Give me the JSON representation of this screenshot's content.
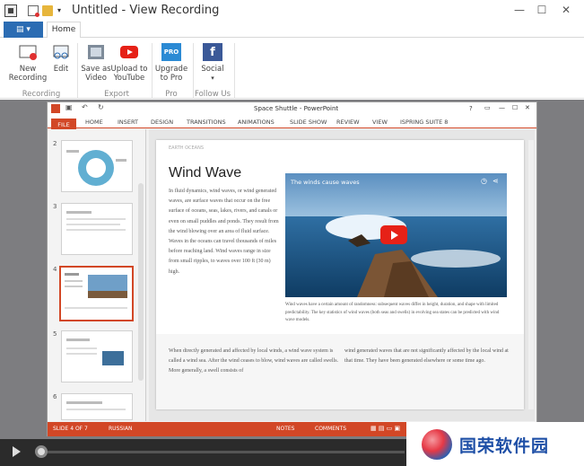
{
  "window": {
    "title": "Untitled - View Recording",
    "quick_access_more": "▾"
  },
  "window_controls": {
    "minimize": "—",
    "maximize": "☐",
    "close": "✕"
  },
  "ribbon": {
    "tab_home": "Home",
    "buttons": {
      "new_recording": "New\nRecording",
      "edit": "Edit",
      "save_as_video": "Save as\nVideo",
      "upload_youtube": "Upload to\nYouTube",
      "upgrade_pro": "Upgrade\nto Pro",
      "social": "Social"
    },
    "groups": {
      "recording": "Recording",
      "export": "Export",
      "pro": "Pro",
      "follow_us": "Follow Us"
    },
    "pro_badge": "PRO",
    "social_badge": "f",
    "colors": {
      "accent": "#2b6cb3",
      "youtube": "#e62117",
      "pro": "#2b8ad4",
      "facebook": "#3b5998"
    }
  },
  "ppt": {
    "title": "Space Shuttle - PowerPoint",
    "help": "?",
    "tabs": [
      "FILE",
      "HOME",
      "INSERT",
      "DESIGN",
      "TRANSITIONS",
      "ANIMATIONS",
      "SLIDE SHOW",
      "REVIEW",
      "VIEW",
      "ISPRING SUITE 8"
    ],
    "thumbnail_numbers": [
      "2",
      "3",
      "4",
      "5",
      "6"
    ],
    "slide": {
      "header": "EARTH OCEANS",
      "title": "Wind Wave",
      "body": "In fluid dynamics, wind waves, or wind generated waves, are surface waves that occur on the free surface of oceans, seas, lakes, rivers, and canals or even on small puddles and ponds. They result from the wind blowing over an area of fluid surface. Waves in the oceans can travel thousands of miles before reaching land. Wind waves range in size from small ripples, to waves over 100 ft (30 m) high.",
      "video_title": "The winds cause waves",
      "video_caption": "Wind waves have a certain amount of randomness: subsequent waves differ in height, duration, and shape with limited predictability. The key statistics of wind waves (both seas and swells) in evolving sea states can be predicted with wind wave models.",
      "col_left": "When directly generated and affected by local winds, a wind wave system is called a wind sea. After the wind ceases to blow, wind waves are called swells. More generally, a swell consists of",
      "col_right": "wind generated waves that are not significantly affected by the local wind at that time. They have been generated elsewhere or some time ago."
    },
    "status": {
      "slide": "SLIDE 4 OF 7",
      "language": "RUSSIAN",
      "notes": "NOTES",
      "comments": "COMMENTS"
    },
    "accent": "#d24726"
  },
  "watermark": {
    "text": "国荣软件园"
  }
}
